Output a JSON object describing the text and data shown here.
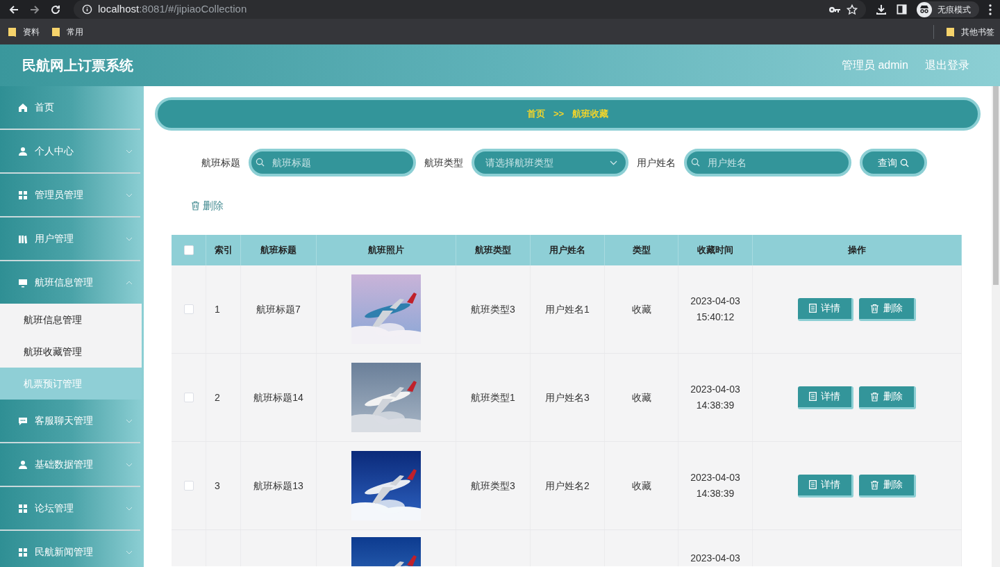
{
  "browser": {
    "url_host": "localhost",
    "url_path": ":8081/#/jipiaoCollection",
    "profile": "无痕模式",
    "bookmarks": [
      "资料",
      "常用"
    ],
    "other_bookmarks": "其他书签"
  },
  "header": {
    "title": "民航网上订票系统",
    "user": "管理员 admin",
    "logout": "退出登录"
  },
  "sidebar": {
    "items": [
      {
        "label": "首页",
        "expandable": false
      },
      {
        "label": "个人中心",
        "expandable": true,
        "expanded": false
      },
      {
        "label": "管理员管理",
        "expandable": true,
        "expanded": false
      },
      {
        "label": "用户管理",
        "expandable": true,
        "expanded": false
      },
      {
        "label": "航班信息管理",
        "expandable": true,
        "expanded": true,
        "children": [
          {
            "label": "航班信息管理",
            "selected": false
          },
          {
            "label": "航班收藏管理",
            "selected": false
          },
          {
            "label": "机票预订管理",
            "selected": true
          }
        ]
      },
      {
        "label": "客服聊天管理",
        "expandable": true,
        "expanded": false
      },
      {
        "label": "基础数据管理",
        "expandable": true,
        "expanded": false
      },
      {
        "label": "论坛管理",
        "expandable": true,
        "expanded": false
      },
      {
        "label": "民航新闻管理",
        "expandable": true,
        "expanded": false
      }
    ]
  },
  "breadcrumb": [
    "首页",
    ">>",
    "航班收藏"
  ],
  "search": {
    "fields": [
      {
        "label": "航班标题",
        "placeholder": "航班标题",
        "kind": "input"
      },
      {
        "label": "航班类型",
        "placeholder": "请选择航班类型",
        "kind": "select"
      },
      {
        "label": "用户姓名",
        "placeholder": "用户姓名",
        "kind": "input"
      }
    ],
    "button": "查询"
  },
  "toolbar": {
    "delete": "删除"
  },
  "table": {
    "header_checked": false,
    "columns": [
      "索引",
      "航班标题",
      "航班照片",
      "航班类型",
      "用户姓名",
      "类型",
      "收藏时间",
      "操作"
    ],
    "rows": [
      {
        "kind": "full",
        "selected": false,
        "index": "1",
        "title": "航班标题7",
        "type": "航班类型3",
        "user": "用户姓名1",
        "fav_type": "收藏",
        "date": "2023-04-03",
        "time": "15:40:12",
        "actions": [
          "详情",
          "删除"
        ]
      },
      {
        "kind": "full",
        "selected": false,
        "index": "2",
        "title": "航班标题14",
        "type": "航班类型1",
        "user": "用户姓名3",
        "fav_type": "收藏",
        "date": "2023-04-03",
        "time": "14:38:39",
        "actions": [
          "详情",
          "删除"
        ]
      },
      {
        "kind": "full",
        "selected": false,
        "index": "3",
        "title": "航班标题13",
        "type": "航班类型3",
        "user": "用户姓名2",
        "fav_type": "收藏",
        "date": "2023-04-03",
        "time": "14:38:39",
        "actions": [
          "详情",
          "删除"
        ]
      },
      {
        "kind": "partial",
        "date": "2023-04-03"
      }
    ]
  }
}
